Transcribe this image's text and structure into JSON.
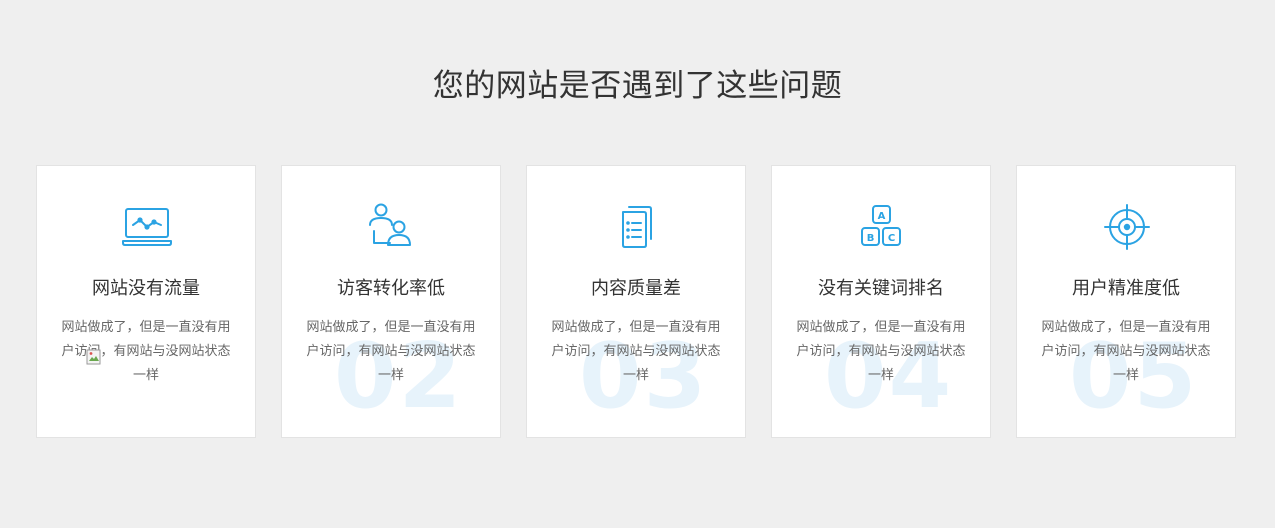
{
  "section": {
    "title": "您的网站是否遇到了这些问题"
  },
  "accent_color": "#2ba3e3",
  "cards": [
    {
      "icon": "laptop-analytics-icon",
      "title": "网站没有流量",
      "desc": "网站做成了，但是一直没有用户访问，有网站与没网站状态一样",
      "number": ""
    },
    {
      "icon": "users-icon",
      "title": "访客转化率低",
      "desc": "网站做成了，但是一直没有用户访问，有网站与没网站状态一样",
      "number": "02"
    },
    {
      "icon": "documents-icon",
      "title": "内容质量差",
      "desc": "网站做成了，但是一直没有用户访问，有网站与没网站状态一样",
      "number": "03"
    },
    {
      "icon": "abc-blocks-icon",
      "title": "没有关键词排名",
      "desc": "网站做成了，但是一直没有用户访问，有网站与没网站状态一样",
      "number": "04"
    },
    {
      "icon": "target-icon",
      "title": "用户精准度低",
      "desc": "网站做成了，但是一直没有用户访问，有网站与没网站状态一样",
      "number": "05"
    }
  ]
}
